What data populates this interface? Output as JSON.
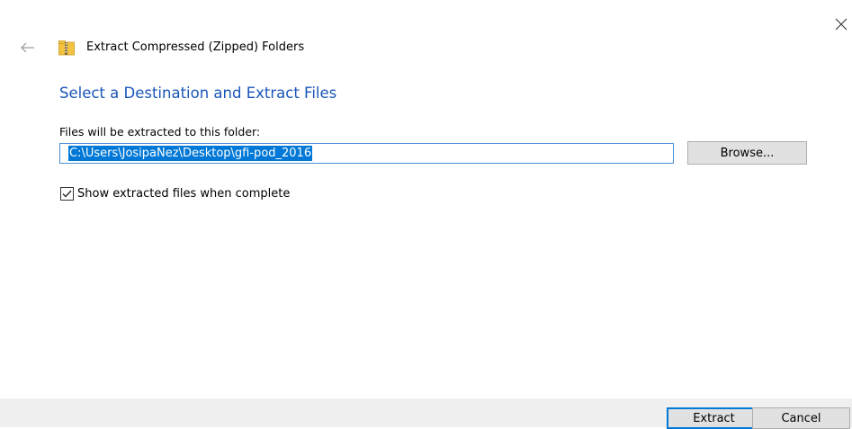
{
  "window": {
    "title": "Extract Compressed (Zipped) Folders",
    "close_icon": "close-icon",
    "back_icon": "back-arrow-icon",
    "app_icon": "zip-folder-icon"
  },
  "main": {
    "heading": "Select a Destination and Extract Files",
    "files_label": "Files will be extracted to this folder:",
    "path_value": "C:\\Users\\JosipaNez\\Desktop\\gfi-pod_2016",
    "browse_label": "Browse...",
    "show_files_label": "Show extracted files when complete",
    "show_files_checked": true
  },
  "footer": {
    "extract_label": "Extract",
    "cancel_label": "Cancel"
  },
  "colors": {
    "heading": "#1a56b9",
    "selection": "#0078d7",
    "button_face": "#e1e1e1",
    "footer_bg": "#f0f0f0"
  }
}
